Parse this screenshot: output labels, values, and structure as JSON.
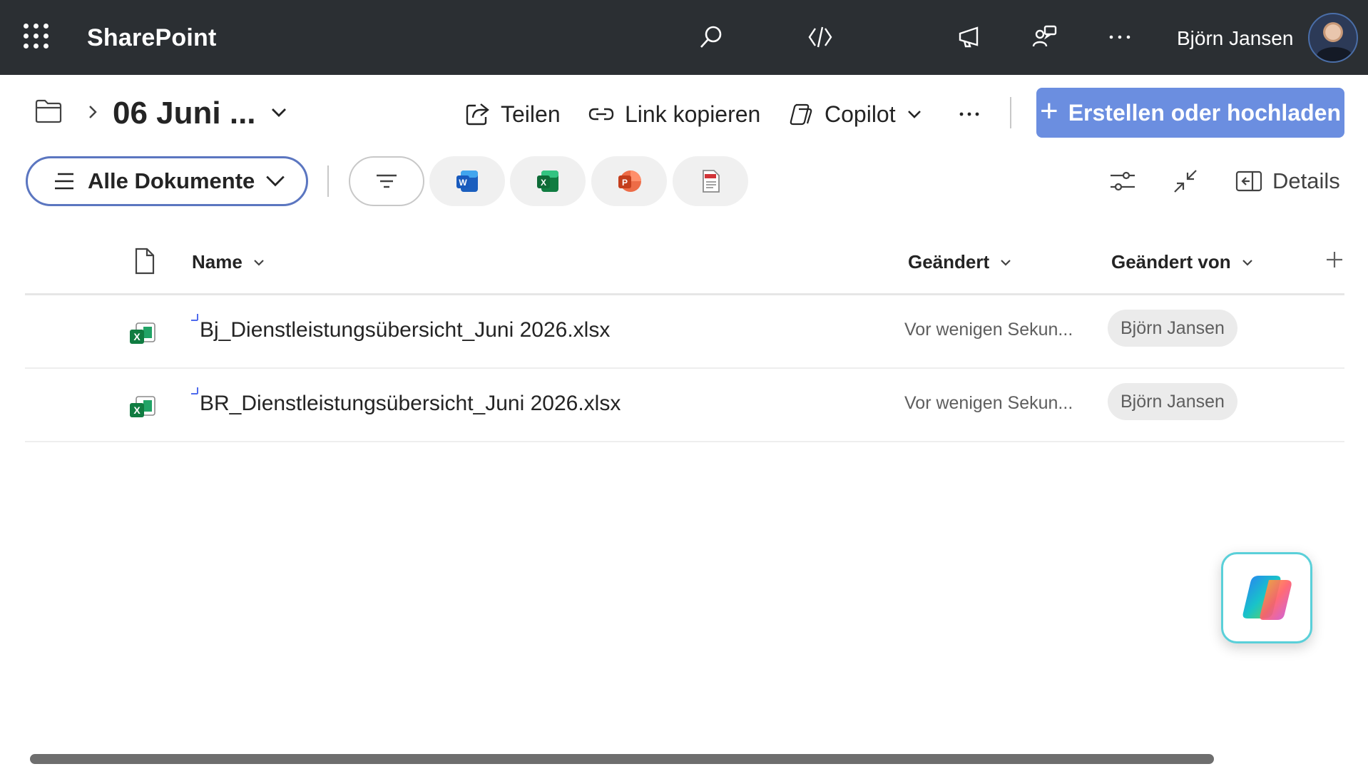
{
  "topbar": {
    "app_name": "SharePoint",
    "user_name": "Björn Jansen",
    "icons": [
      "app-launcher-icon",
      "search-icon",
      "copilot-code-icon",
      "megaphone-icon",
      "feedback-icon",
      "more-icon"
    ],
    "background": "#2b2f33"
  },
  "breadcrumb": {
    "title": "06 Juni ..."
  },
  "commands": {
    "share": "Teilen",
    "copy_link": "Link kopieren",
    "copilot": "Copilot",
    "more": "...",
    "create_upload": "Erstellen oder hochladen",
    "primary_color": "#6b8ee0"
  },
  "view": {
    "selected": "Alle Dokumente",
    "filters": [
      "filter-icon",
      "word-icon",
      "excel-icon",
      "powerpoint-icon",
      "pdf-icon"
    ],
    "details_label": "Details",
    "accent_color": "#5b76c0"
  },
  "table": {
    "columns": {
      "name": "Name",
      "modified": "Geändert",
      "modified_by": "Geändert von"
    },
    "rows": [
      {
        "file_name": "Bj_Dienstleistungsübersicht_Juni 2026.xlsx",
        "modified": "Vor wenigen Sekun...",
        "modified_by": "Björn Jansen"
      },
      {
        "file_name": "BR_Dienstleistungsübersicht_Juni 2026.xlsx",
        "modified": "Vor wenigen Sekun...",
        "modified_by": "Björn Jansen"
      }
    ]
  }
}
